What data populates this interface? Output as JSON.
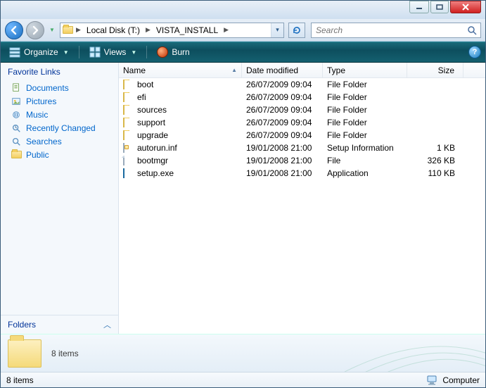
{
  "breadcrumb": {
    "seg1": "Local Disk (T:)",
    "seg2": "VISTA_INSTALL"
  },
  "search": {
    "placeholder": "Search"
  },
  "toolbar": {
    "organize": "Organize",
    "views": "Views",
    "burn": "Burn"
  },
  "sidebar": {
    "heading": "Favorite Links",
    "items": [
      {
        "label": "Documents"
      },
      {
        "label": "Pictures"
      },
      {
        "label": "Music"
      },
      {
        "label": "Recently Changed"
      },
      {
        "label": "Searches"
      },
      {
        "label": "Public"
      }
    ],
    "folders": "Folders"
  },
  "columns": {
    "name": "Name",
    "date": "Date modified",
    "type": "Type",
    "size": "Size"
  },
  "files": [
    {
      "name": "boot",
      "date": "26/07/2009 09:04",
      "type": "File Folder",
      "size": "",
      "icon": "folder"
    },
    {
      "name": "efi",
      "date": "26/07/2009 09:04",
      "type": "File Folder",
      "size": "",
      "icon": "folder"
    },
    {
      "name": "sources",
      "date": "26/07/2009 09:04",
      "type": "File Folder",
      "size": "",
      "icon": "folder"
    },
    {
      "name": "support",
      "date": "26/07/2009 09:04",
      "type": "File Folder",
      "size": "",
      "icon": "folder"
    },
    {
      "name": "upgrade",
      "date": "26/07/2009 09:04",
      "type": "File Folder",
      "size": "",
      "icon": "folder"
    },
    {
      "name": "autorun.inf",
      "date": "19/01/2008 21:00",
      "type": "Setup Information",
      "size": "1 KB",
      "icon": "inf"
    },
    {
      "name": "bootmgr",
      "date": "19/01/2008 21:00",
      "type": "File",
      "size": "326 KB",
      "icon": "file"
    },
    {
      "name": "setup.exe",
      "date": "19/01/2008 21:00",
      "type": "Application",
      "size": "110 KB",
      "icon": "app"
    }
  ],
  "details": {
    "summary": "8 items"
  },
  "status": {
    "left": "8 items",
    "right": "Computer"
  }
}
